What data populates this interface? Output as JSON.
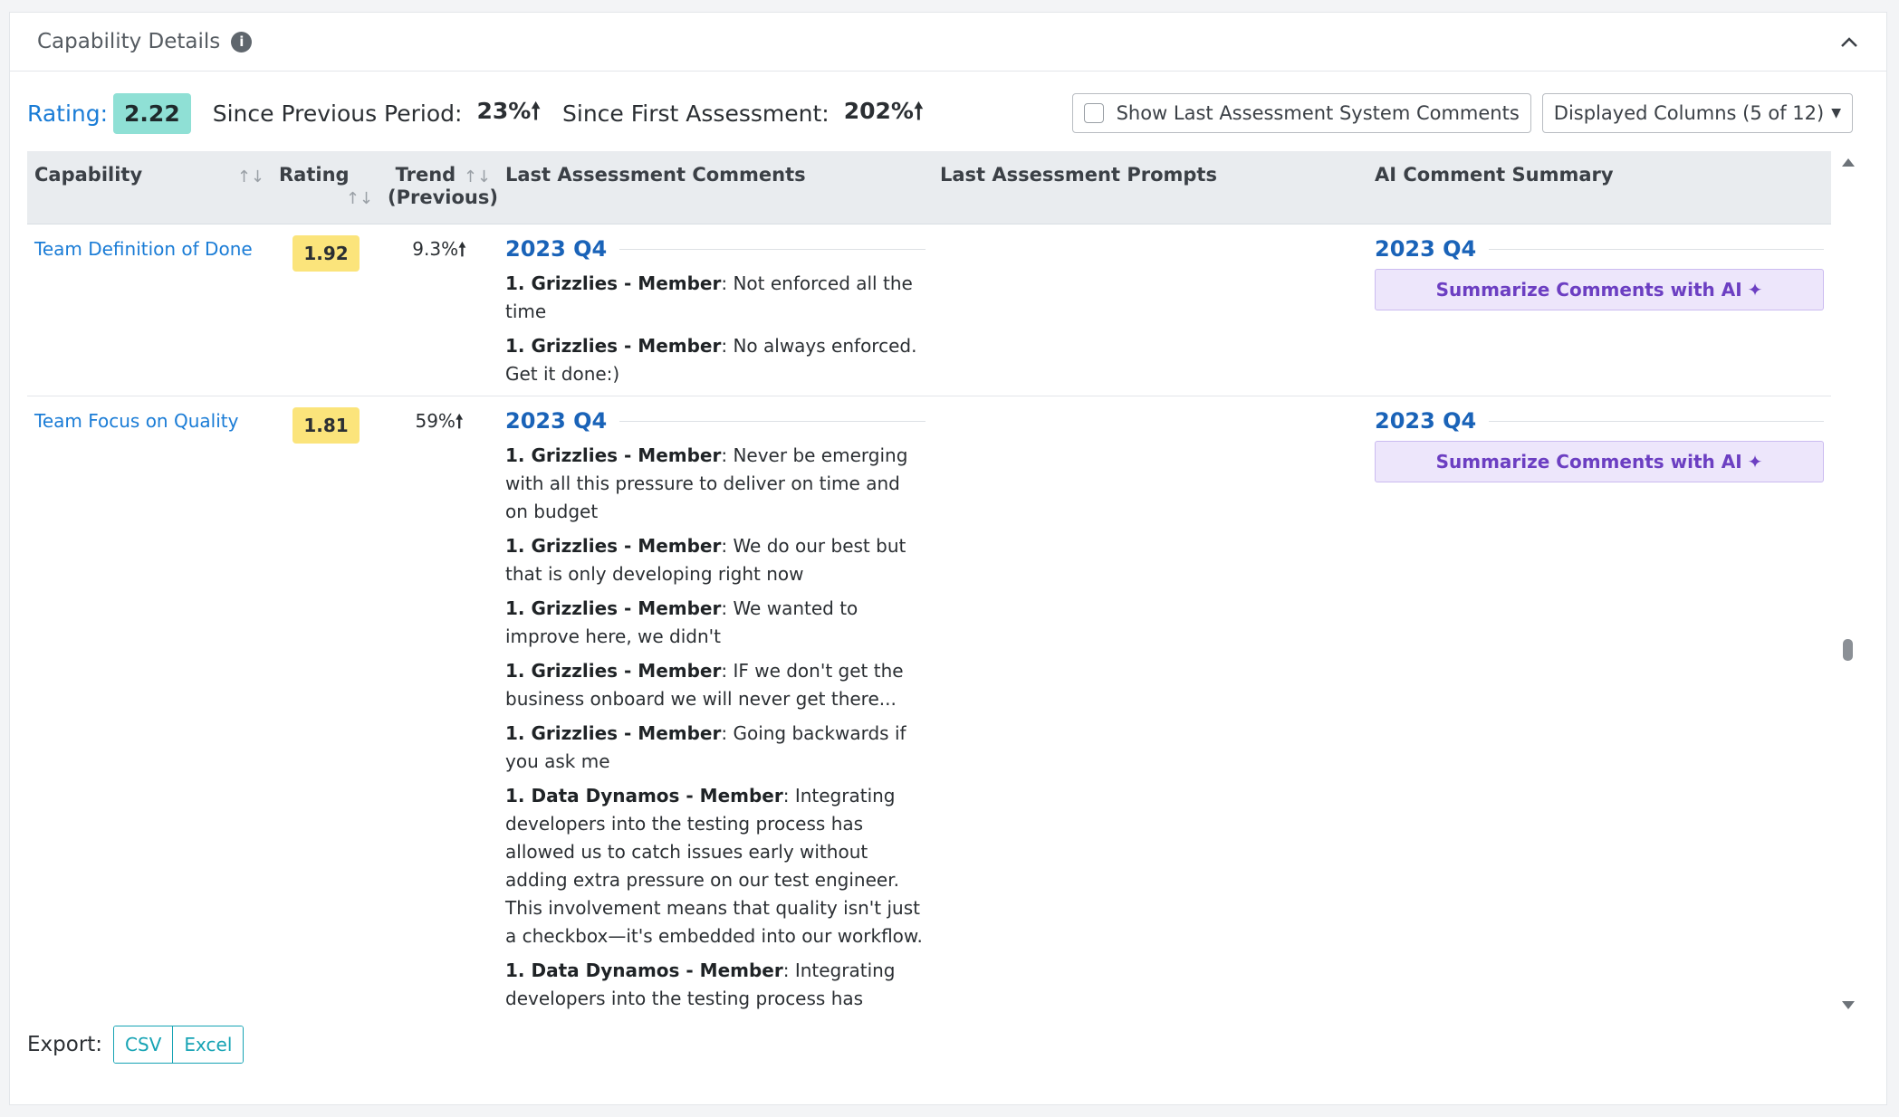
{
  "header": {
    "title": "Capability Details"
  },
  "summary": {
    "rating_label": "Rating:",
    "rating_value": "2.22",
    "since_previous_label": "Since Previous Period:",
    "since_previous_value": "23%",
    "since_first_label": "Since First Assessment:",
    "since_first_value": "202%"
  },
  "toolbar": {
    "show_comments_label": "Show Last Assessment System Comments",
    "show_comments_checked": false,
    "displayed_columns_label": "Displayed Columns (5 of 12)"
  },
  "table": {
    "columns": [
      "Capability",
      "Rating",
      "Trend (Previous)",
      "Last Assessment Comments",
      "Last Assessment Prompts",
      "AI Comment Summary"
    ],
    "trend_col_line1": "Trend",
    "trend_col_line2": "(Previous)",
    "ai_button_label": "Summarize Comments with AI",
    "rows": [
      {
        "capability": "Team Definition of Done",
        "rating": "1.92",
        "trend": "9.3%",
        "period": "2023 Q4",
        "comments": [
          {
            "author": "1. Grizzlies - Member",
            "text": ": Not enforced all the time"
          },
          {
            "author": "1. Grizzlies - Member",
            "text": ": No always enforced. Get it done:)"
          }
        ],
        "ai_period": "2023 Q4"
      },
      {
        "capability": "Team Focus on Quality",
        "rating": "1.81",
        "trend": "59%",
        "period": "2023 Q4",
        "comments": [
          {
            "author": "1. Grizzlies - Member",
            "text": ": Never be emerging with all this pressure to deliver on time and on budget"
          },
          {
            "author": "1. Grizzlies - Member",
            "text": ": We do our best but that is only developing right now"
          },
          {
            "author": "1. Grizzlies - Member",
            "text": ": We wanted to improve here, we didn't"
          },
          {
            "author": "1. Grizzlies - Member",
            "text": ": IF we don't get the business onboard we will never get there..."
          },
          {
            "author": "1. Grizzlies - Member",
            "text": ": Going backwards if you ask me"
          },
          {
            "author": "1. Data Dynamos - Member",
            "text": ": Integrating developers into the testing process has allowed us to catch issues early without adding extra pressure on our test engineer. This involvement means that quality isn't just a checkbox—it's embedded into our workflow."
          },
          {
            "author": "1. Data Dynamos - Member",
            "text": ": Integrating developers into the testing process has enhanced our commitment to quality. This involvement ensures issues are caught early,"
          }
        ],
        "ai_period": "2023 Q4"
      }
    ]
  },
  "export": {
    "label": "Export:",
    "csv": "CSV",
    "excel": "Excel"
  }
}
